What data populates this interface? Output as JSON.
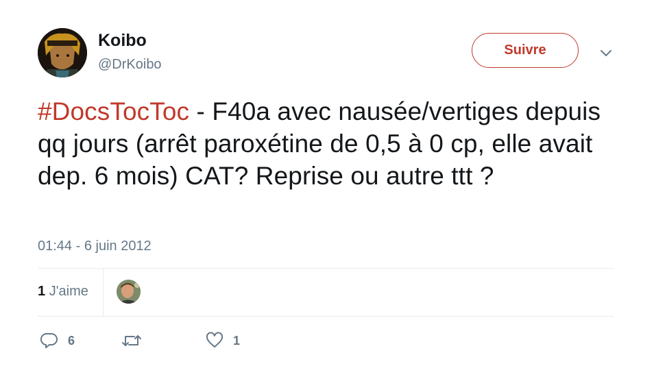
{
  "author": {
    "name": "Koibo",
    "handle": "@DrKoibo"
  },
  "follow_button_label": "Suivre",
  "tweet": {
    "hashtag": "#DocsTocToc",
    "text": " - F40a avec nausée/vertiges depuis qq jours (arrêt paroxétine de 0,5 à 0 cp, elle avait dep. 6 mois) CAT? Reprise ou autre ttt ?",
    "timestamp": "01:44 - 6 juin 2012"
  },
  "stats": {
    "likes_count": "1",
    "likes_label": "J'aime"
  },
  "actions": {
    "reply_count": "6",
    "retweet_count": "",
    "like_count": "1"
  },
  "colors": {
    "accent": "#c0392b",
    "secondary_text": "#657786",
    "divider": "#e6ecf0"
  },
  "icons": [
    "chevron-down-icon",
    "reply-icon",
    "retweet-icon",
    "heart-icon"
  ]
}
